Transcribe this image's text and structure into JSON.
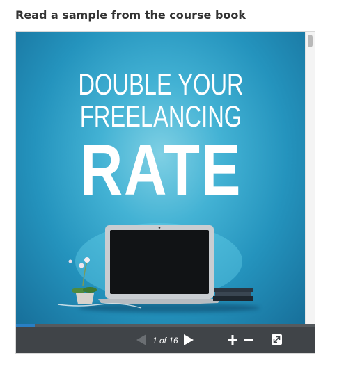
{
  "section": {
    "heading": "Read a sample from the course book"
  },
  "book": {
    "cover_title_line1": "DOUBLE YOUR",
    "cover_title_line2": "FREELANCING",
    "cover_title_line3": "RATE"
  },
  "viewer": {
    "page_indicator": "1 of 16",
    "current_page": 1,
    "total_pages": 16,
    "progress_fraction": 0.0625,
    "icons": {
      "prev": "triangle-left-icon",
      "next": "triangle-right-icon",
      "zoom_in": "plus-icon",
      "zoom_out": "minus-icon",
      "fullscreen": "expand-icon"
    }
  },
  "colors": {
    "toolbar": "#404448",
    "progress": "#2a7fc4",
    "cover_blue": "#2493bd"
  }
}
